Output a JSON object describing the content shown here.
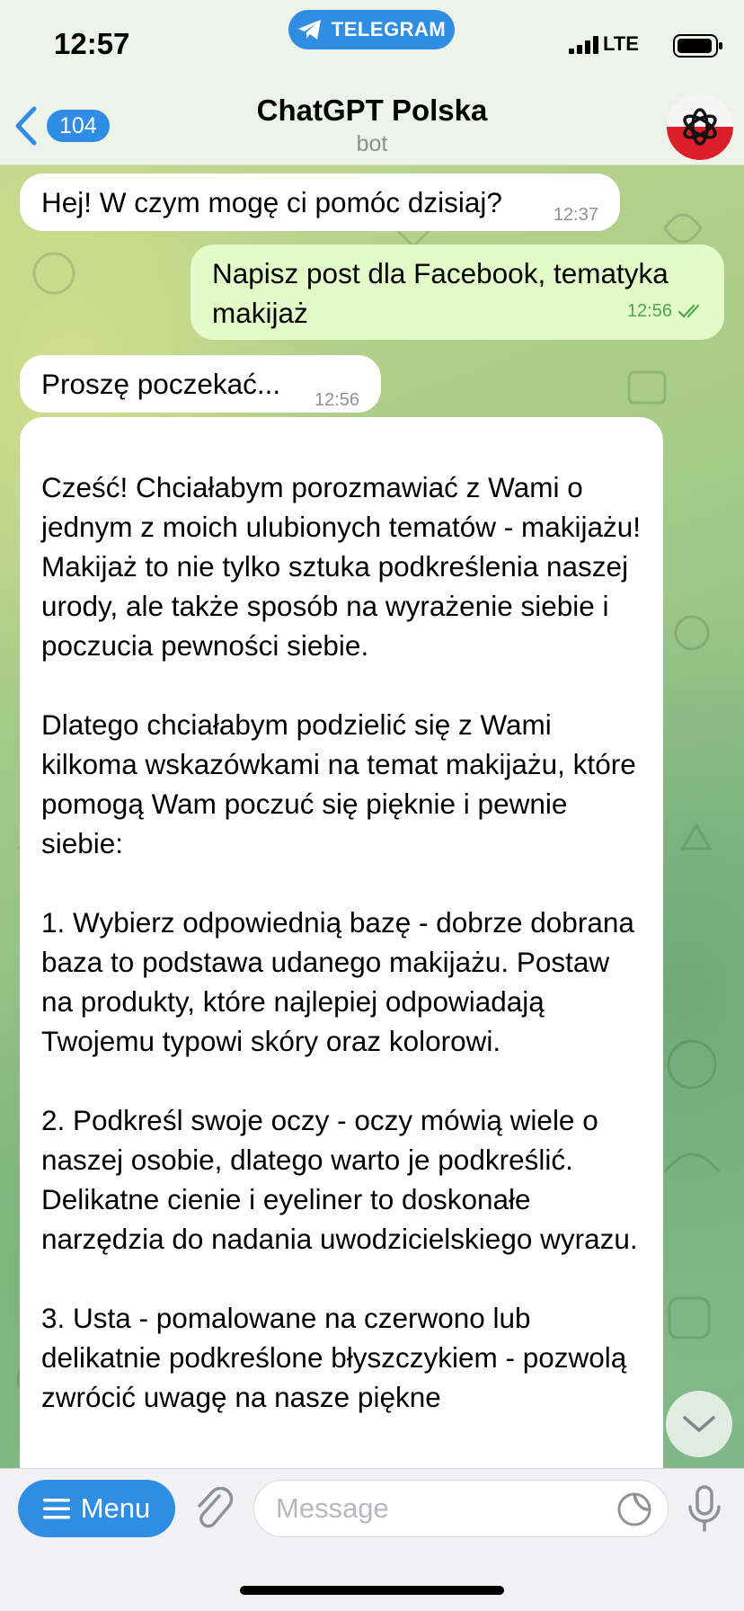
{
  "status_bar": {
    "time": "12:57",
    "network": "LTE",
    "app_pill": "TELEGRAM"
  },
  "header": {
    "back_count": "104",
    "title": "ChatGPT Polska",
    "subtitle": "bot",
    "accent_color": "#2f8de4"
  },
  "messages": [
    {
      "direction": "incoming",
      "text": "Hej! W czym mogę ci pomóc dzisiaj?",
      "time": "12:37"
    },
    {
      "direction": "outgoing",
      "text": "Napisz post dla Facebook, tematyka makijaż",
      "time": "12:56",
      "read": true
    },
    {
      "direction": "incoming",
      "text": "Proszę poczekać...",
      "time": "12:56"
    },
    {
      "direction": "incoming",
      "text": "Cześć! Chciałabym porozmawiać z Wami o jednym z moich ulubionych tematów - makijażu! Makijaż to nie tylko sztuka podkreślenia naszej urody, ale także sposób na wyrażenie siebie i poczucia pewności siebie.\n\nDlatego chciałabym podzielić się z Wami kilkoma wskazówkami na temat makijażu, które pomogą Wam poczuć się pięknie i pewnie siebie:\n\n1. Wybierz odpowiednią bazę - dobrze dobrana baza to podstawa udanego makijażu. Postaw na produkty, które najlepiej odpowiadają Twojemu typowi skóry oraz kolorowi.\n\n2. Podkreśl swoje oczy - oczy mówią wiele o naszej osobie, dlatego warto je podkreślić. Delikatne cienie i eyeliner to doskonałe narzędzia do nadania uwodzicielskiego wyrazu.\n\n3. Usta - pomalowane na czerwono lub delikatnie podkreślone błyszczykiem - pozwolą zwrócić uwagę na nasze piękne"
    }
  ],
  "composer": {
    "menu_label": "Menu",
    "input_placeholder": "Message",
    "input_value": ""
  },
  "icons": {
    "back": "chevron-left-icon",
    "attach": "paperclip-icon",
    "sticker": "sticker-icon",
    "mic": "microphone-icon",
    "scroll": "chevron-down-icon"
  }
}
